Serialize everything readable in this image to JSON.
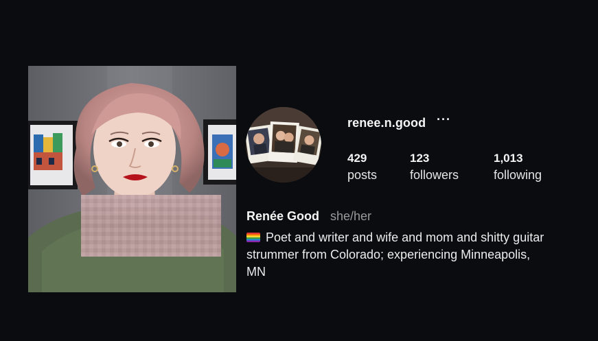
{
  "profile": {
    "username": "renee.n.good",
    "more_label": "···",
    "stats": [
      {
        "value": "429",
        "label": "posts"
      },
      {
        "value": "123",
        "label": "followers"
      },
      {
        "value": "1,013",
        "label": "following"
      }
    ],
    "full_name": "Renée Good",
    "pronouns": "she/her",
    "bio_icon": "rainbow-flag-icon",
    "bio_text": "Poet and writer and wife and mom and shitty guitar strummer from Colorado; experiencing Minneapolis, MN"
  },
  "colors": {
    "background": "#0b0c10",
    "text_primary": "#f5f5f5",
    "text_secondary": "#9a9a9a"
  }
}
